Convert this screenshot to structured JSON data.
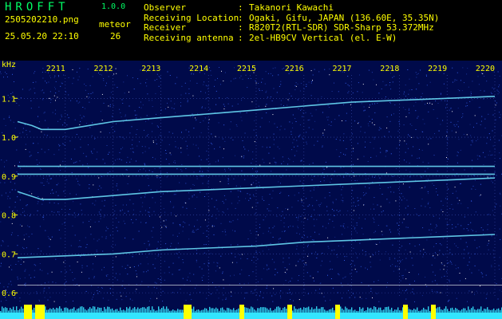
{
  "header": {
    "app_title": "HROFFT",
    "app_version": "1.0.0",
    "file_name": "2505202210.png",
    "timestamp": "25.05.20 22:10",
    "meteor_label": "meteor",
    "meteor_count": "26",
    "info": [
      {
        "key": "Observer",
        "value": "Takanori Kawachi"
      },
      {
        "key": "Receiving Location",
        "value": "Ogaki, Gifu, JAPAN (136.60E, 35.35N)"
      },
      {
        "key": "Receiver",
        "value": "R820T2(RTL-SDR) SDR-Sharp 53.372MHz"
      },
      {
        "key": "Receiving antenna",
        "value": "2el-HB9CV Vertical (el. E-W)"
      }
    ]
  },
  "chart_data": {
    "type": "heatmap",
    "ylabel": "kHz",
    "y_ticks": [
      "1.1",
      "1.0",
      "0.9",
      "0.8",
      "0.7",
      "0.6"
    ],
    "y_tick_values": [
      1.1,
      1.0,
      0.9,
      0.8,
      0.7,
      0.6
    ],
    "ylim": [
      0.59,
      1.16
    ],
    "x_ticks": [
      "2211",
      "2212",
      "2213",
      "2214",
      "2215",
      "2216",
      "2217",
      "2218",
      "2219",
      "2220"
    ],
    "x_range_minutes": [
      0,
      10
    ],
    "grid": true,
    "signals": [
      {
        "x": [
          0,
          0.3,
          0.5,
          1,
          2,
          3,
          4,
          5,
          6,
          7,
          8,
          9,
          10
        ],
        "y": [
          1.04,
          1.03,
          1.02,
          1.02,
          1.04,
          1.05,
          1.06,
          1.07,
          1.08,
          1.09,
          1.095,
          1.1,
          1.105
        ]
      },
      {
        "x": [
          0,
          10
        ],
        "y": [
          0.905,
          0.905
        ]
      },
      {
        "x": [
          0,
          10
        ],
        "y": [
          0.925,
          0.925
        ]
      },
      {
        "x": [
          0,
          0.5,
          1,
          2,
          3,
          4,
          5,
          6,
          7,
          8,
          9,
          10
        ],
        "y": [
          0.86,
          0.84,
          0.84,
          0.85,
          0.86,
          0.865,
          0.87,
          0.875,
          0.88,
          0.885,
          0.89,
          0.895
        ]
      },
      {
        "x": [
          0,
          1,
          2,
          3,
          4,
          5,
          6,
          7,
          8,
          9,
          10
        ],
        "y": [
          0.69,
          0.695,
          0.7,
          0.71,
          0.715,
          0.72,
          0.73,
          0.735,
          0.74,
          0.745,
          0.75
        ]
      }
    ],
    "reference_line": 0.62,
    "colors": {
      "background": "#000a4a",
      "noise": "#3a6aff",
      "signal": "#6fe6ff",
      "text": "#ffff00",
      "meter": "#33e5ff",
      "meter_peak": "#ffff00"
    }
  }
}
